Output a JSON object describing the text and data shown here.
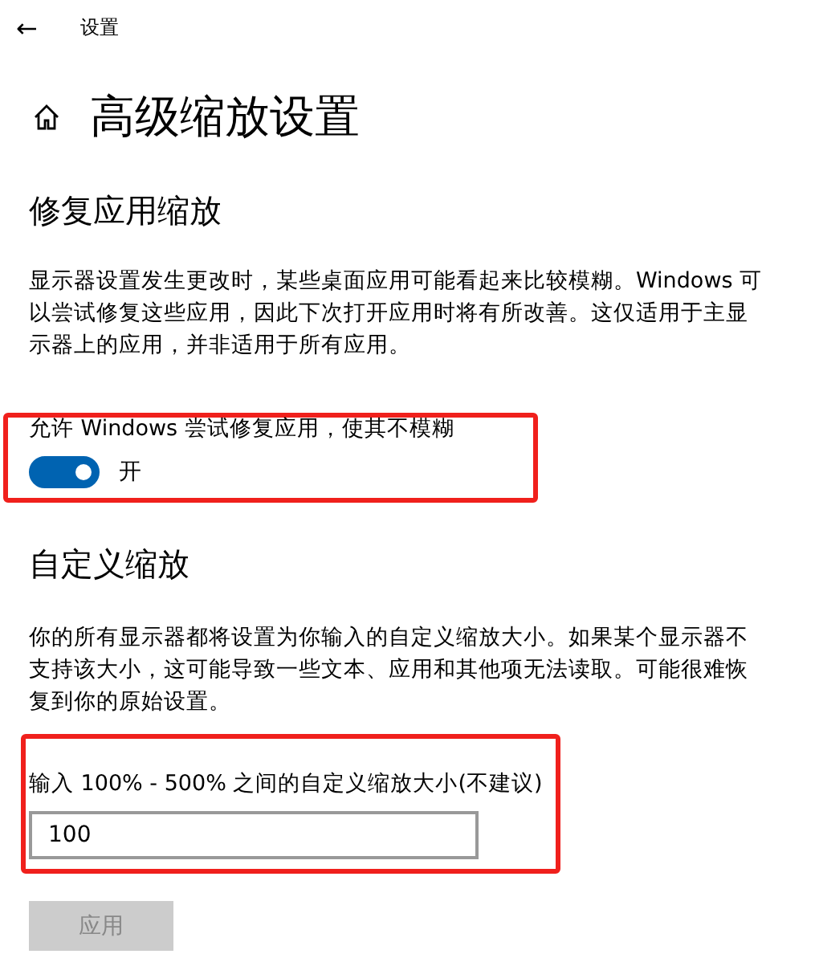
{
  "header": {
    "back": "←",
    "title": "设置"
  },
  "page_title": "高级缩放设置",
  "fix_section": {
    "heading": "修复应用缩放",
    "description": "显示器设置发生更改时，某些桌面应用可能看起来比较模糊。Windows 可以尝试修复这些应用，因此下次打开应用时将有所改善。这仅适用于主显示器上的应用，并非适用于所有应用。",
    "highlighted": true,
    "toggle": {
      "label": "允许 Windows 尝试修复应用，使其不模糊",
      "on": true,
      "state_text": "开"
    }
  },
  "custom_section": {
    "heading": "自定义缩放",
    "description": "你的所有显示器都将设置为你输入的自定义缩放大小。如果某个显示器不支持该大小，这可能导致一些文本、应用和其他项无法读取。可能很难恢复到你的原始设置。",
    "highlighted": true,
    "field": {
      "label": "输入 100% - 500% 之间的自定义缩放大小(不建议)",
      "value": "100"
    },
    "apply_button": {
      "label": "应用",
      "disabled": true
    }
  }
}
